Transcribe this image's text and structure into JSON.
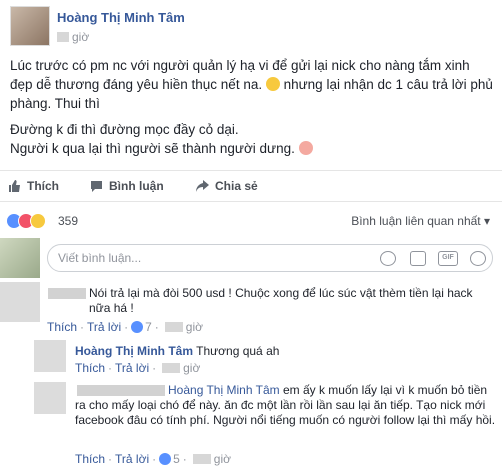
{
  "post": {
    "author": "Hoàng Thị Minh Tâm",
    "time_suffix": "giờ",
    "paragraph1": "Lúc trước có pm nc với người quản lý hạ vi để gửi lại nick cho nàng tắm xinh đẹp dễ thương đáng yêu hiền thục nết na.",
    "paragraph1_tail": "nhưng lại nhận dc 1 câu trả lời phủ phàng. Thui thì",
    "line2": "Đường k đi thì đường mọc đầy cỏ dại.",
    "line3": "Người k qua lại thì người sẽ thành người dưng."
  },
  "actions": {
    "like": "Thích",
    "comment": "Bình luận",
    "share": "Chia sẻ"
  },
  "reactions": {
    "count": "359",
    "sort_label": "Bình luận liên quan nhất ▾"
  },
  "comment_box": {
    "placeholder": "Viết bình luận..."
  },
  "comments": [
    {
      "text": "Nói trả lại mà đòi 500 usd ! Chuộc xong để lúc súc vật thèm tiền lại hack nữa há !",
      "like": "Thích",
      "reply": "Trả lời",
      "reactions": "7",
      "time": "giờ"
    },
    {
      "author": "Hoàng Thị Minh Tâm",
      "text": "Thương quá ah",
      "like": "Thích",
      "reply": "Trả lời",
      "time": "giờ"
    },
    {
      "mention": "Hoàng Thị Minh Tâm",
      "text": "em ấy k muốn lấy lại vì k muốn bỏ tiền ra cho mấy loại chó để này. ăn đc một lần rồi lần sau lại ăn tiếp. Tạo nick mới facebook đâu có tính phí. Người nổi tiếng muốn có người follow lại thì mấy hồi.",
      "like": "Thích",
      "reply": "Trả lời",
      "reactions": "5",
      "time": "giờ"
    }
  ]
}
